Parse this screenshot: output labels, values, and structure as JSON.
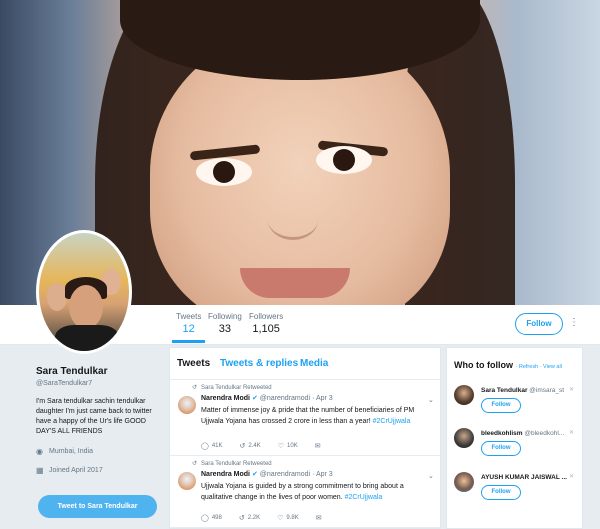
{
  "profile": {
    "name": "Sara Tendulkar",
    "handle": "@SaraTendulkar7",
    "bio": "I'm Sara tendulkar sachin tendulkar daughter I'm just came back to twitter have a happy of the Ur's life GOOD DAY'S ALL FRIENDS",
    "location": "Mumbai, India",
    "joined": "Joined April 2017",
    "tweet_to_label": "Tweet to Sara Tendulkar"
  },
  "stats": {
    "tweets_label": "Tweets",
    "tweets_value": "12",
    "following_label": "Following",
    "following_value": "33",
    "followers_label": "Followers",
    "followers_value": "1,105"
  },
  "header": {
    "follow_label": "Follow",
    "more_icon": "more-dots-icon"
  },
  "timeline": {
    "tabs": [
      "Tweets",
      "Tweets & replies",
      "Media"
    ],
    "tweets": [
      {
        "retweet_label": "Sara Tendulkar Retweeted",
        "author": "Narendra Modi",
        "handle": "@narendramodi",
        "date": "· Apr 3",
        "text": "Matter of immense joy & pride that the number of beneficiaries of PM Ujjwala Yojana has crossed 2 crore in less than a year!",
        "hashtag": "#2CrUjjwala",
        "replies": "41K",
        "retweets": "2.4K",
        "likes": "10K"
      },
      {
        "retweet_label": "Sara Tendulkar Retweeted",
        "author": "Narendra Modi",
        "handle": "@narendramodi",
        "date": "· Apr 3",
        "text": "Ujjwala Yojana is guided by a strong commitment to bring about a qualitative change in the lives of poor women.",
        "hashtag": "#2CrUjjwala",
        "replies": "498",
        "retweets": "2.2K",
        "likes": "9.8K"
      }
    ]
  },
  "who_to_follow": {
    "title": "Who to follow",
    "refresh": "Refresh",
    "view_all": "View all",
    "follow_label": "Follow",
    "suggestions": [
      {
        "name": "Sara Tendulkar",
        "handle": "@imsara_st"
      },
      {
        "name": "bleedkohlism",
        "handle": "@bleedkohl..."
      },
      {
        "name": "AYUSH KUMAR JAISWAL ...",
        "handle": ""
      }
    ]
  },
  "colors": {
    "accent": "#1da1f2",
    "page_bg": "#e6ecf0",
    "tweet_to_button": "#4fb3f0"
  }
}
